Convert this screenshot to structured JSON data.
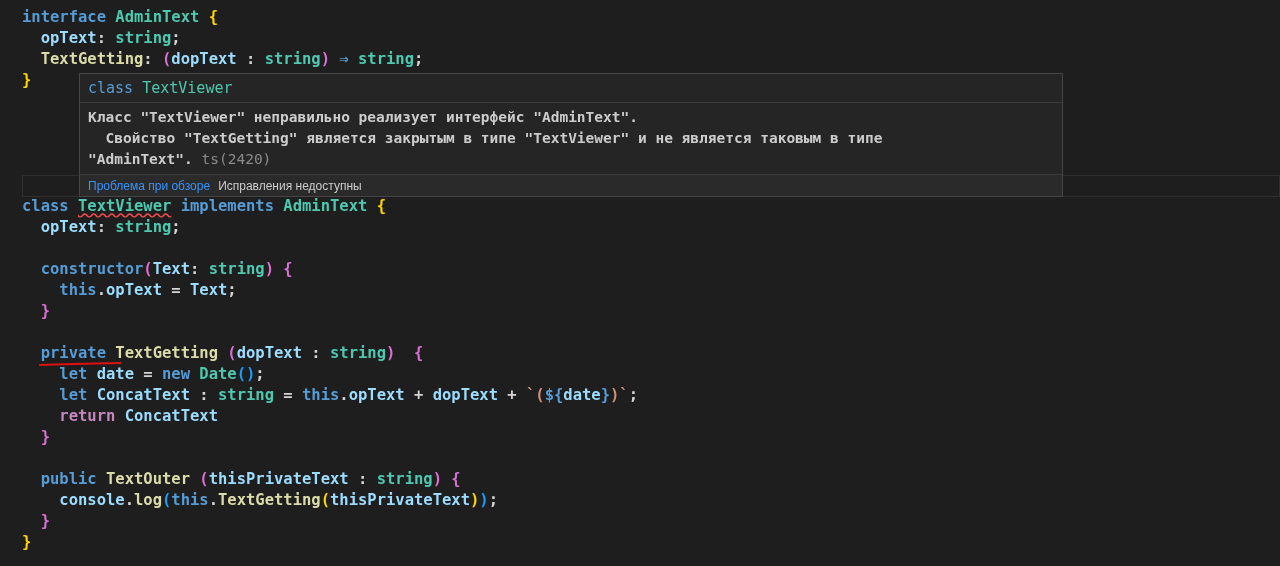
{
  "editor": {
    "lines": [
      {
        "kind": "code",
        "tokens": [
          {
            "text": "interface ",
            "kind": "kw"
          },
          {
            "text": "AdminText ",
            "kind": "type"
          },
          {
            "text": "{",
            "kind": "b1"
          }
        ]
      },
      {
        "kind": "code",
        "tokens": [
          {
            "text": "  opText",
            "kind": "var"
          },
          {
            "text": ": ",
            "kind": "p"
          },
          {
            "text": "string",
            "kind": "type"
          },
          {
            "text": ";",
            "kind": "p"
          }
        ]
      },
      {
        "kind": "code",
        "tokens": [
          {
            "text": "  TextGetting",
            "kind": "fn"
          },
          {
            "text": ": ",
            "kind": "p"
          },
          {
            "text": "(",
            "kind": "b2"
          },
          {
            "text": "dopText ",
            "kind": "var"
          },
          {
            "text": ": ",
            "kind": "p"
          },
          {
            "text": "string",
            "kind": "type"
          },
          {
            "text": ")",
            "kind": "b2"
          },
          {
            "text": " ⇒ ",
            "kind": "kw"
          },
          {
            "text": "string",
            "kind": "type"
          },
          {
            "text": ";",
            "kind": "p"
          }
        ]
      },
      {
        "kind": "code",
        "tokens": [
          {
            "text": "}",
            "kind": "b1"
          }
        ]
      },
      {
        "kind": "blank"
      },
      {
        "kind": "blank"
      },
      {
        "kind": "blank"
      },
      {
        "kind": "blank"
      },
      {
        "kind": "blank"
      },
      {
        "kind": "code",
        "tokens": [
          {
            "text": "class ",
            "kind": "kw"
          },
          {
            "text": "TextViewer",
            "kind": "type-error"
          },
          {
            "text": " implements ",
            "kind": "kw"
          },
          {
            "text": "AdminText ",
            "kind": "type"
          },
          {
            "text": "{",
            "kind": "b1"
          }
        ]
      },
      {
        "kind": "code",
        "tokens": [
          {
            "text": "  opText",
            "kind": "var"
          },
          {
            "text": ": ",
            "kind": "p"
          },
          {
            "text": "string",
            "kind": "type"
          },
          {
            "text": ";",
            "kind": "p"
          }
        ]
      },
      {
        "kind": "blank"
      },
      {
        "kind": "code",
        "tokens": [
          {
            "text": "  constructor",
            "kind": "kw"
          },
          {
            "text": "(",
            "kind": "b2"
          },
          {
            "text": "Text",
            "kind": "var"
          },
          {
            "text": ": ",
            "kind": "p"
          },
          {
            "text": "string",
            "kind": "type"
          },
          {
            "text": ") ",
            "kind": "b2"
          },
          {
            "text": "{",
            "kind": "b2"
          }
        ]
      },
      {
        "kind": "code",
        "tokens": [
          {
            "text": "    this",
            "kind": "kw"
          },
          {
            "text": ".",
            "kind": "p"
          },
          {
            "text": "opText",
            "kind": "var"
          },
          {
            "text": " = ",
            "kind": "p"
          },
          {
            "text": "Text",
            "kind": "var"
          },
          {
            "text": ";",
            "kind": "p"
          }
        ]
      },
      {
        "kind": "code",
        "tokens": [
          {
            "text": "  }",
            "kind": "b2"
          }
        ]
      },
      {
        "kind": "blank"
      },
      {
        "kind": "code",
        "tokens": [
          {
            "text": "  private ",
            "kind": "kw"
          },
          {
            "text": "TextGetting ",
            "kind": "fn"
          },
          {
            "text": "(",
            "kind": "b2"
          },
          {
            "text": "dopText ",
            "kind": "var"
          },
          {
            "text": ": ",
            "kind": "p"
          },
          {
            "text": "string",
            "kind": "type"
          },
          {
            "text": ")  ",
            "kind": "b2"
          },
          {
            "text": "{",
            "kind": "b2"
          }
        ]
      },
      {
        "kind": "code",
        "tokens": [
          {
            "text": "    let ",
            "kind": "kw"
          },
          {
            "text": "date",
            "kind": "var"
          },
          {
            "text": " = ",
            "kind": "p"
          },
          {
            "text": "new ",
            "kind": "kw"
          },
          {
            "text": "Date",
            "kind": "type"
          },
          {
            "text": "()",
            "kind": "b3"
          },
          {
            "text": ";",
            "kind": "p"
          }
        ]
      },
      {
        "kind": "code",
        "tokens": [
          {
            "text": "    let ",
            "kind": "kw"
          },
          {
            "text": "ConcatText ",
            "kind": "var"
          },
          {
            "text": ": ",
            "kind": "p"
          },
          {
            "text": "string",
            "kind": "type"
          },
          {
            "text": " = ",
            "kind": "p"
          },
          {
            "text": "this",
            "kind": "kw"
          },
          {
            "text": ".",
            "kind": "p"
          },
          {
            "text": "opText",
            "kind": "var"
          },
          {
            "text": " + ",
            "kind": "p"
          },
          {
            "text": "dopText",
            "kind": "var"
          },
          {
            "text": " + ",
            "kind": "p"
          },
          {
            "text": "`(",
            "kind": "str"
          },
          {
            "text": "${",
            "kind": "kw"
          },
          {
            "text": "date",
            "kind": "var"
          },
          {
            "text": "}",
            "kind": "kw"
          },
          {
            "text": ")`",
            "kind": "str"
          },
          {
            "text": ";",
            "kind": "p"
          }
        ]
      },
      {
        "kind": "code",
        "tokens": [
          {
            "text": "    return ",
            "kind": "ctrl"
          },
          {
            "text": "ConcatText",
            "kind": "var"
          }
        ]
      },
      {
        "kind": "code",
        "tokens": [
          {
            "text": "  }",
            "kind": "b2"
          }
        ]
      },
      {
        "kind": "blank"
      },
      {
        "kind": "code",
        "tokens": [
          {
            "text": "  public ",
            "kind": "kw"
          },
          {
            "text": "TextOuter ",
            "kind": "fn"
          },
          {
            "text": "(",
            "kind": "b2"
          },
          {
            "text": "thisPrivateText ",
            "kind": "var"
          },
          {
            "text": ": ",
            "kind": "p"
          },
          {
            "text": "string",
            "kind": "type"
          },
          {
            "text": ") ",
            "kind": "b2"
          },
          {
            "text": "{",
            "kind": "b2"
          }
        ]
      },
      {
        "kind": "code",
        "tokens": [
          {
            "text": "    console",
            "kind": "var"
          },
          {
            "text": ".",
            "kind": "p"
          },
          {
            "text": "log",
            "kind": "fn"
          },
          {
            "text": "(",
            "kind": "b3"
          },
          {
            "text": "this",
            "kind": "kw"
          },
          {
            "text": ".",
            "kind": "p"
          },
          {
            "text": "TextGetting",
            "kind": "fn"
          },
          {
            "text": "(",
            "kind": "b1"
          },
          {
            "text": "thisPrivateText",
            "kind": "var"
          },
          {
            "text": ")",
            "kind": "b1"
          },
          {
            "text": ")",
            "kind": "b3"
          },
          {
            "text": ";",
            "kind": "p"
          }
        ]
      },
      {
        "kind": "code",
        "tokens": [
          {
            "text": "  }",
            "kind": "b2"
          }
        ]
      },
      {
        "kind": "code",
        "tokens": [
          {
            "text": "}",
            "kind": "b1"
          }
        ]
      }
    ]
  },
  "hover": {
    "signature": [
      {
        "text": "class ",
        "kind": "kw"
      },
      {
        "text": "TextViewer",
        "kind": "type"
      }
    ],
    "message": [
      "Класс \"TextViewer\" неправильно реализует интерфейс \"AdminText\".",
      "  Свойство \"TextGetting\" является закрытым в типе \"TextViewer\" и не является таковым в типе",
      "\"AdminText\"."
    ],
    "code": "ts(2420)",
    "link": "Проблема при обзоре",
    "status": "Исправления недоступны"
  }
}
